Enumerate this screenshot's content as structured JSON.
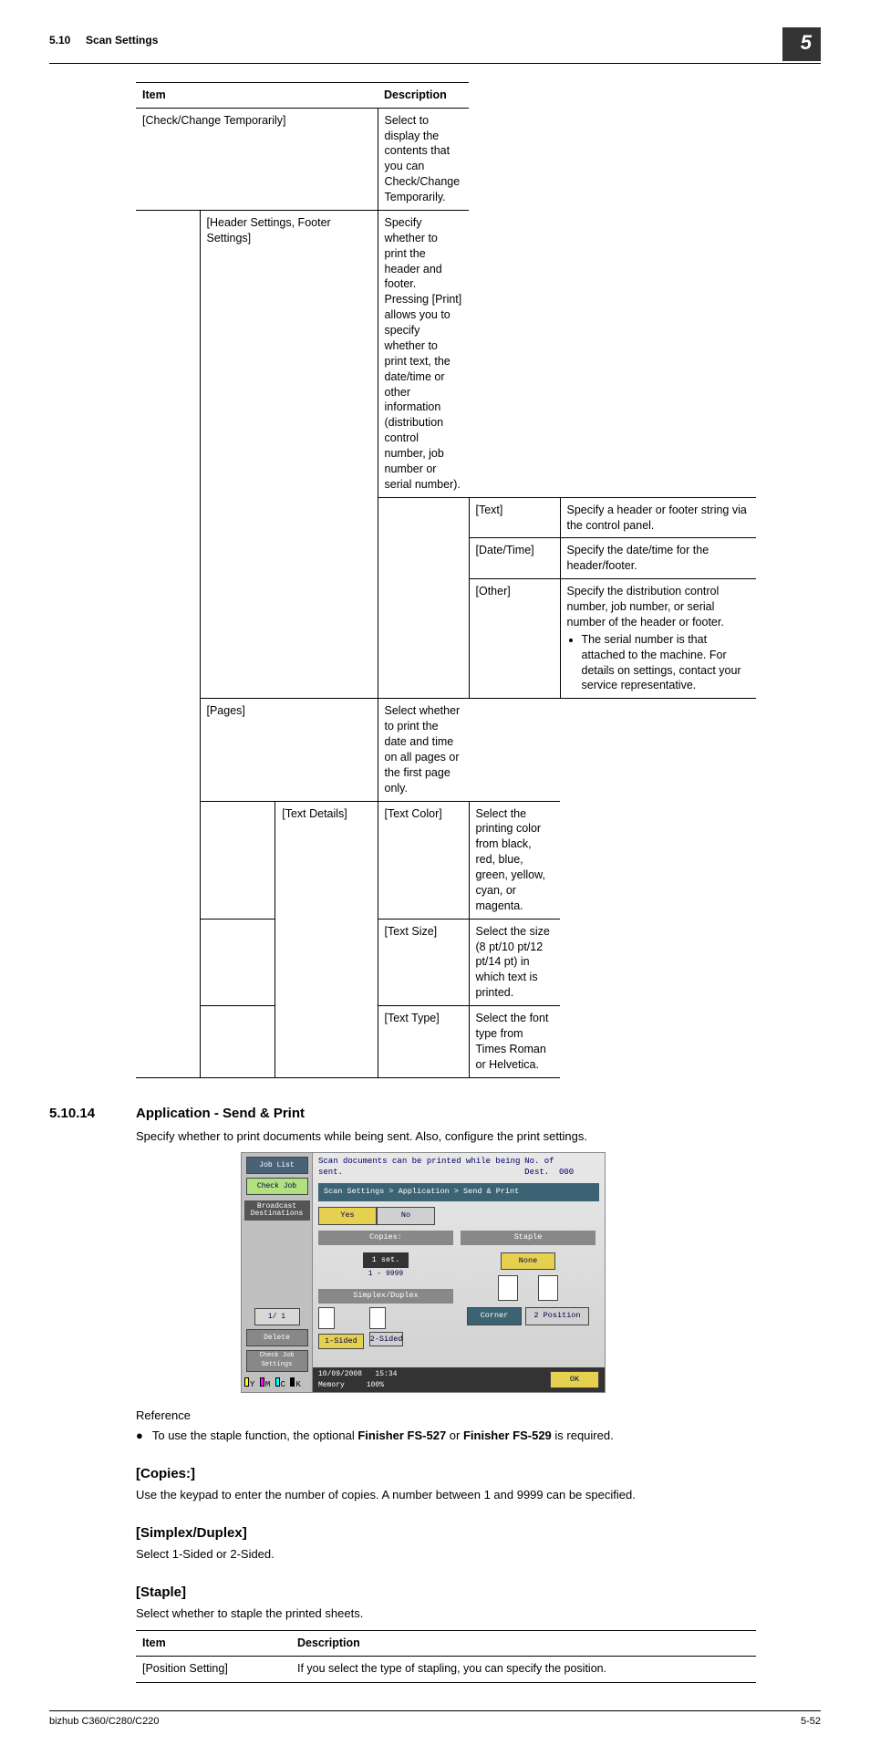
{
  "header": {
    "section_num": "5.10",
    "section_title": "Scan Settings",
    "chapter_num": "5"
  },
  "table1": {
    "h_item": "Item",
    "h_desc": "Description",
    "r1_item": "[Check/Change Temporarily]",
    "r1_desc": "Select to display the contents that you can Check/Change Temporarily.",
    "r2_item": "[Header Settings, Footer Settings]",
    "r2_desc": "Specify whether to print the header and footer. Pressing [Print] allows you to specify whether to print text, the date/time or other information (distribution control number, job number or serial number).",
    "r3_item": "[Text]",
    "r3_desc": "Specify a header or footer string via the control panel.",
    "r4_item": "[Date/Time]",
    "r4_desc": "Specify the date/time for the header/footer.",
    "r5_item": "[Other]",
    "r5_desc": "Specify the distribution control number, job number, or serial number of the header or footer.",
    "r5_bullet": "The serial number is that attached to the machine. For details on settings, contact your service representative.",
    "r6_item": "[Pages]",
    "r6_desc": "Select whether to print the date and time on all pages or the first page only.",
    "r7_item": "[Text Details]",
    "r7a_item": "[Text Color]",
    "r7a_desc": "Select the printing color from black, red, blue, green, yellow, cyan, or magenta.",
    "r7b_item": "[Text Size]",
    "r7b_desc": "Select the size (8 pt/10 pt/12 pt/14 pt) in which text is printed.",
    "r7c_item": "[Text Type]",
    "r7c_desc": "Select the font type from Times Roman or Helvetica."
  },
  "sec": {
    "num": "5.10.14",
    "title": "Application - Send & Print",
    "intro": "Specify whether to print documents while being sent. Also, configure the print settings."
  },
  "panel": {
    "job_list": "Job List",
    "check_job": "Check Job",
    "broadcast": "Broadcast Destinations",
    "pager": "1/  1",
    "delete": "Delete",
    "check_set": "Check Job Settings",
    "msg": "Scan documents can be printed while being sent.",
    "dest": "No. of Dest.",
    "dest_n": "000",
    "crumb": "Scan Settings > Application > Send & Print",
    "yes": "Yes",
    "no": "No",
    "copies": "Copies:",
    "staple": "Staple",
    "one_set": "1 set.",
    "range": "1   -   9999",
    "none": "None",
    "sd": "Simplex/Duplex",
    "corner": "Corner",
    "twopos": "2 Position",
    "onesided": "1-Sided",
    "twosided": "2-Sided",
    "date": "10/09/2008",
    "time": "15:34",
    "mem": "Memory",
    "memv": "100%",
    "ok": "OK"
  },
  "reference": {
    "label": "Reference",
    "text_pre": "To use the staple function, the optional ",
    "b1": "Finisher FS-527",
    "or": " or ",
    "b2": "Finisher FS-529",
    "text_post": " is required."
  },
  "copies": {
    "head": "[Copies:]",
    "text": "Use the keypad to enter the number of copies. A number between 1 and 9999 can be specified."
  },
  "sd": {
    "head": "[Simplex/Duplex]",
    "text": "Select 1-Sided or 2-Sided."
  },
  "staple": {
    "head": "[Staple]",
    "text": "Select whether to staple the printed sheets."
  },
  "table2": {
    "h_item": "Item",
    "h_desc": "Description",
    "r1_item": "[Position Setting]",
    "r1_desc": "If you select the type of stapling, you can specify the position."
  },
  "footer": {
    "model": "bizhub C360/C280/C220",
    "page": "5-52"
  }
}
